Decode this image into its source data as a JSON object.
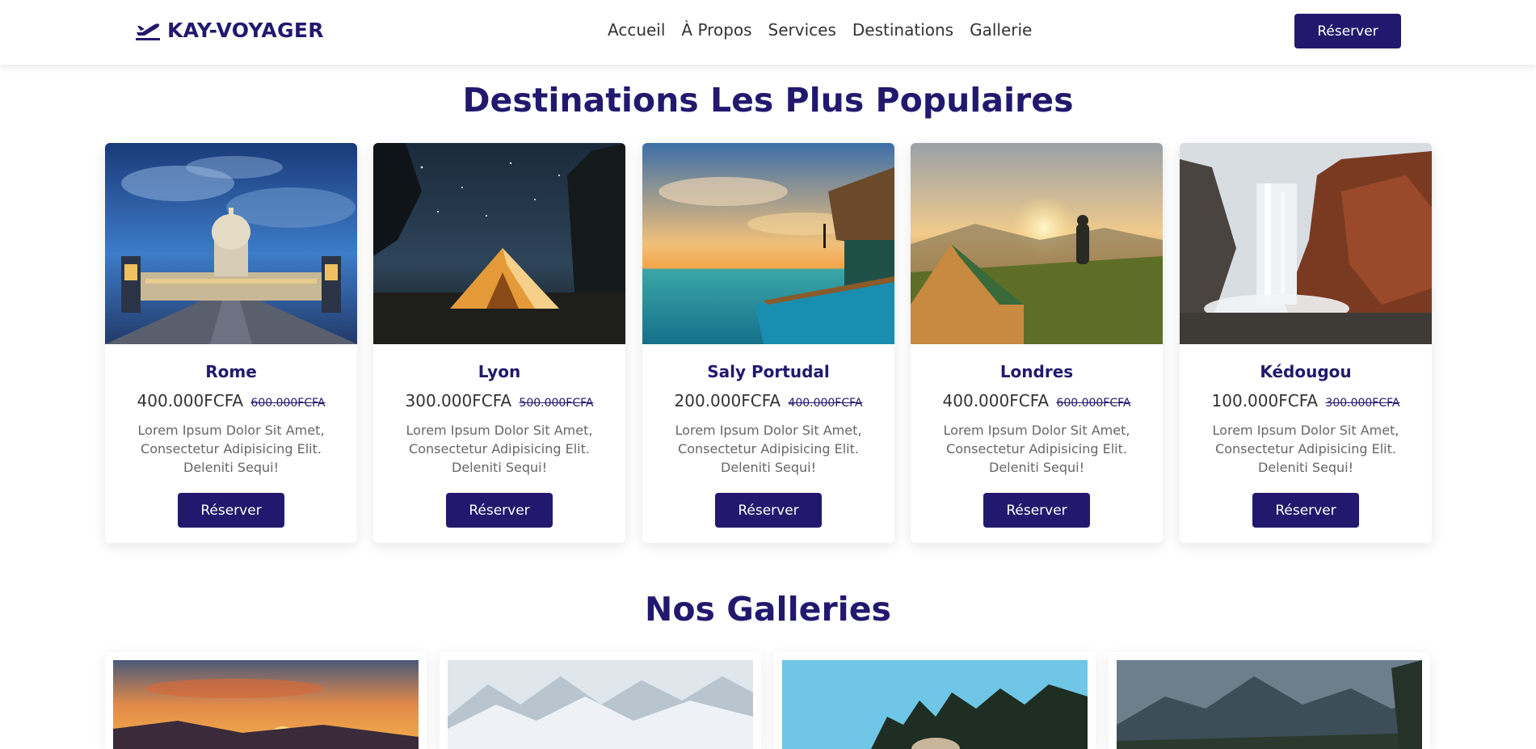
{
  "brand": {
    "name": "KAY-VOYAGER"
  },
  "nav": [
    "Accueil",
    "À Propos",
    "Services",
    "Destinations",
    "Gallerie"
  ],
  "header_button": "Réserver",
  "destinations": {
    "title": "Destinations Les Plus Populaires",
    "cards": [
      {
        "name": "Rome",
        "price": "400.000FCFA",
        "old_price": "600.000FCFA",
        "desc": "Lorem Ipsum Dolor Sit Amet, Consectetur Adipisicing Elit. Deleniti Sequi!",
        "button": "Réserver",
        "image": "capitol-building-night-photo"
      },
      {
        "name": "Lyon",
        "price": "300.000FCFA",
        "old_price": "500.000FCFA",
        "desc": "Lorem Ipsum Dolor Sit Amet, Consectetur Adipisicing Elit. Deleniti Sequi!",
        "button": "Réserver",
        "image": "tent-under-stars-photo"
      },
      {
        "name": "Saly Portudal",
        "price": "200.000FCFA",
        "old_price": "400.000FCFA",
        "desc": "Lorem Ipsum Dolor Sit Amet, Consectetur Adipisicing Elit. Deleniti Sequi!",
        "button": "Réserver",
        "image": "sunset-ocean-pool-photo"
      },
      {
        "name": "Londres",
        "price": "400.000FCFA",
        "old_price": "600.000FCFA",
        "desc": "Lorem Ipsum Dolor Sit Amet, Consectetur Adipisicing Elit. Deleniti Sequi!",
        "button": "Réserver",
        "image": "tent-hiker-sunrise-photo"
      },
      {
        "name": "Kédougou",
        "price": "100.000FCFA",
        "old_price": "300.000FCFA",
        "desc": "Lorem Ipsum Dolor Sit Amet, Consectetur Adipisicing Elit. Deleniti Sequi!",
        "button": "Réserver",
        "image": "waterfall-cliff-photo"
      }
    ]
  },
  "galleries": {
    "title": "Nos Galleries",
    "images": [
      "sunset-sky-photo",
      "snowy-mountains-photo",
      "forest-lake-photo",
      "mountain-valley-photo"
    ]
  },
  "colors": {
    "primary": "#22196e",
    "text": "#333333",
    "muted": "#666666"
  }
}
